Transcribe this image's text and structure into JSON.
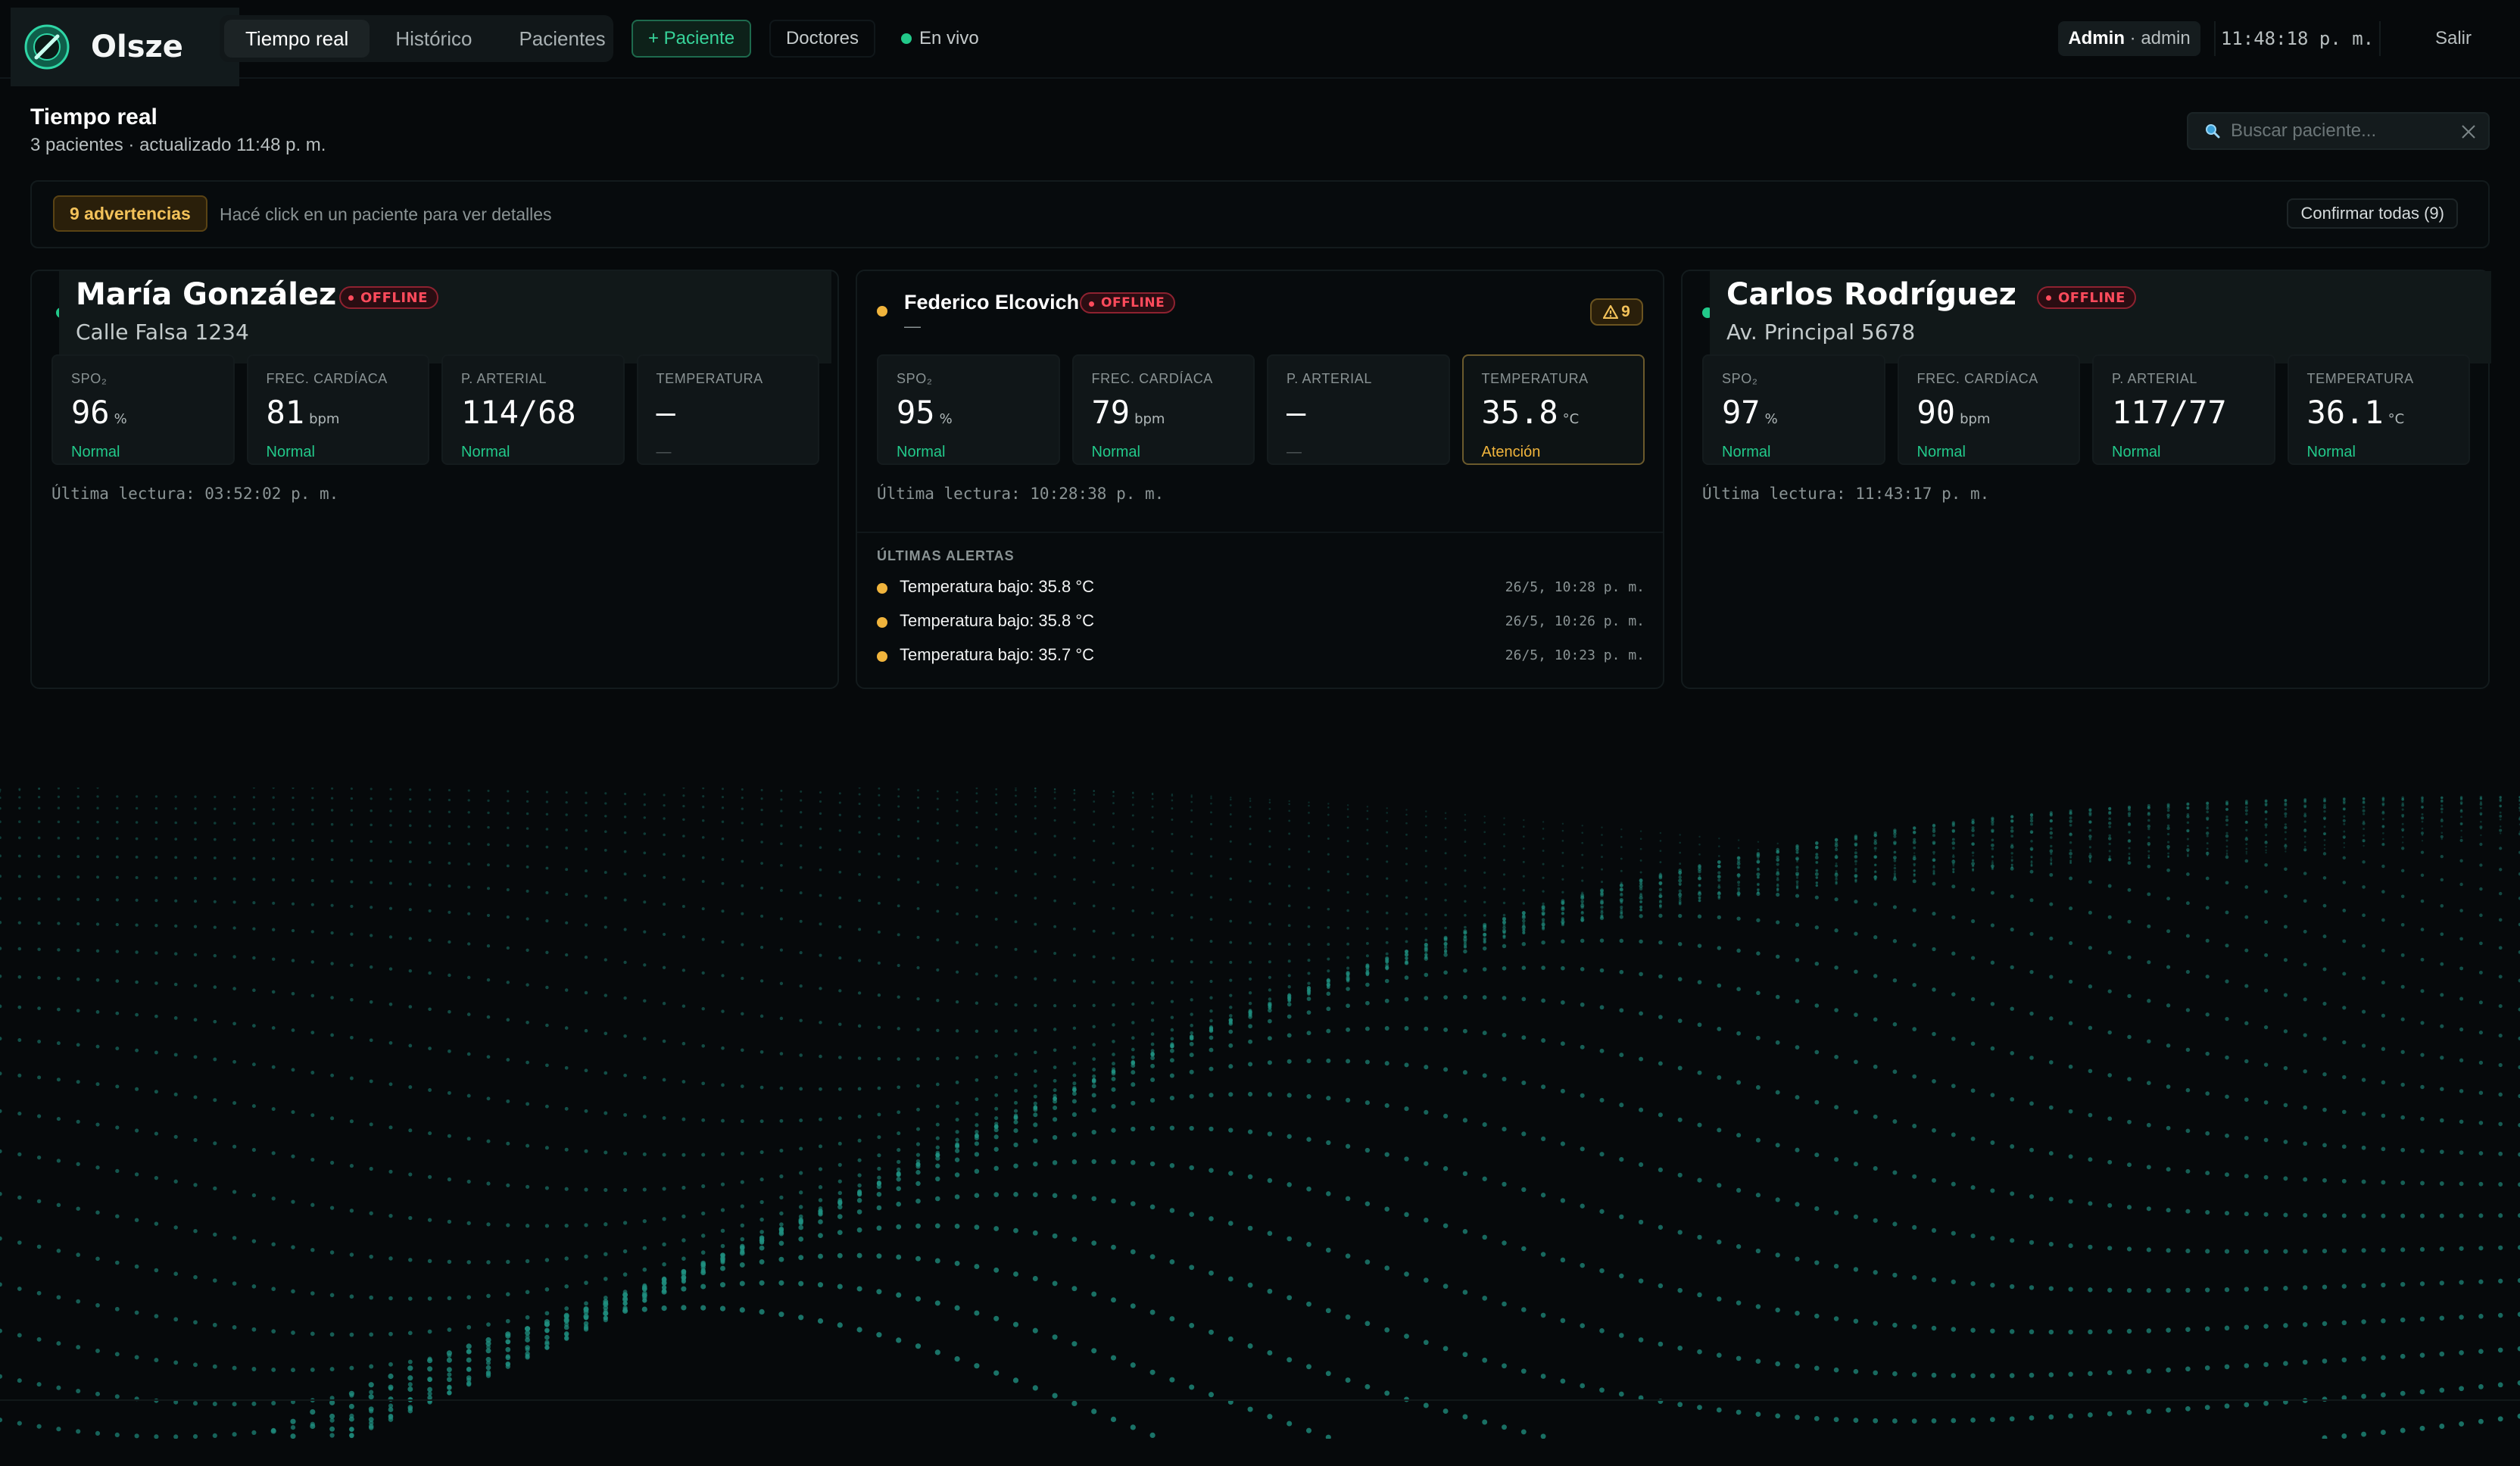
{
  "brand": {
    "name": "Olsze"
  },
  "nav": {
    "tabs": [
      {
        "label": "Tiempo real",
        "active": true
      },
      {
        "label": "Histórico",
        "active": false
      },
      {
        "label": "Pacientes",
        "active": false
      }
    ],
    "add_patient": "+ Paciente",
    "doctors": "Doctores",
    "live": "En vivo"
  },
  "user": {
    "role": "Admin",
    "name": "· admin"
  },
  "clock": "11:48:18 p. m.",
  "logout": "Salir",
  "header": {
    "title": "Tiempo real",
    "subtitle": "3 pacientes · actualizado 11:48 p. m."
  },
  "search": {
    "placeholder": "Buscar paciente..."
  },
  "alertbar": {
    "count_label": "9 advertencias",
    "hint": "Hacé click en un paciente para ver detalles",
    "confirm": "Confirmar todas (9)"
  },
  "colors": {
    "accent": "#22c98a",
    "warning": "#f0b43c",
    "offline": "#ff4b5c",
    "background": "#06090b"
  },
  "patients": [
    {
      "name": "María González",
      "address": "Calle Falsa 1234",
      "status": "OFFLINE",
      "status_dot": "#22c98a",
      "metrics": [
        {
          "label": "SPO₂",
          "value": "96",
          "unit": "%",
          "status": "Normal"
        },
        {
          "label": "FREC. CARDÍACA",
          "value": "81",
          "unit": "bpm",
          "status": "Normal"
        },
        {
          "label": "P. ARTERIAL",
          "value": "114/68",
          "unit": "",
          "status": "Normal"
        },
        {
          "label": "TEMPERATURA",
          "value": "—",
          "unit": "",
          "status": "—"
        }
      ],
      "last_reading": "Última lectura: 03:52:02 p. m."
    },
    {
      "name": "Federico Elcovich",
      "address": "—",
      "status": "OFFLINE",
      "status_dot": "#f0b43c",
      "warn_badge": "9",
      "metrics": [
        {
          "label": "SPO₂",
          "value": "95",
          "unit": "%",
          "status": "Normal"
        },
        {
          "label": "FREC. CARDÍACA",
          "value": "79",
          "unit": "bpm",
          "status": "Normal"
        },
        {
          "label": "P. ARTERIAL",
          "value": "—",
          "unit": "",
          "status": "—"
        },
        {
          "label": "TEMPERATURA",
          "value": "35.8",
          "unit": "°C",
          "status": "Atención"
        }
      ],
      "last_reading": "Última lectura: 10:28:38 p. m.",
      "alerts_title": "ÚLTIMAS ALERTAS",
      "alerts": [
        {
          "text": "Temperatura bajo: 35.8 °C",
          "time": "26/5, 10:28 p. m."
        },
        {
          "text": "Temperatura bajo: 35.8 °C",
          "time": "26/5, 10:26 p. m."
        },
        {
          "text": "Temperatura bajo: 35.7 °C",
          "time": "26/5, 10:23 p. m."
        }
      ]
    },
    {
      "name": "Carlos Rodríguez",
      "address": "Av. Principal 5678",
      "status": "OFFLINE",
      "status_dot": "#22c98a",
      "metrics": [
        {
          "label": "SPO₂",
          "value": "97",
          "unit": "%",
          "status": "Normal"
        },
        {
          "label": "FREC. CARDÍACA",
          "value": "90",
          "unit": "bpm",
          "status": "Normal"
        },
        {
          "label": "P. ARTERIAL",
          "value": "117/77",
          "unit": "",
          "status": "Normal"
        },
        {
          "label": "TEMPERATURA",
          "value": "36.1",
          "unit": "°C",
          "status": "Normal"
        }
      ],
      "last_reading": "Última lectura: 11:43:17 p. m."
    }
  ]
}
